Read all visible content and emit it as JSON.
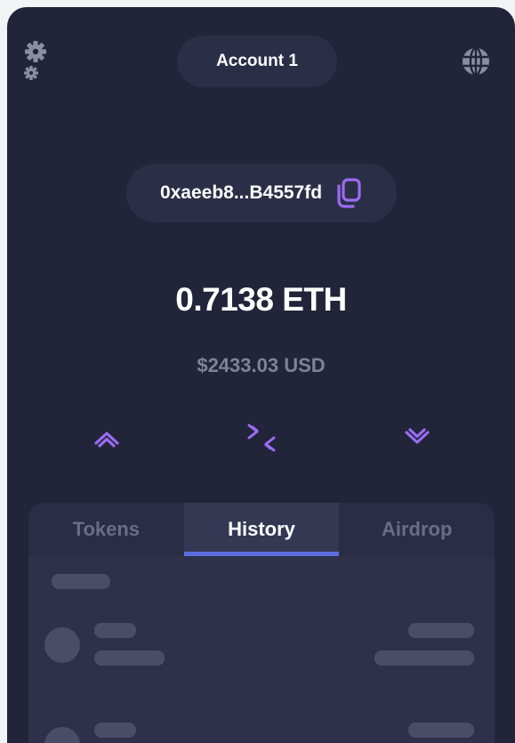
{
  "header": {
    "account_name": "Account 1",
    "settings_icon": "gear-icon",
    "network_icon": "globe-icon"
  },
  "address": {
    "short": "0xaeeb8...B4557fd",
    "copy_icon": "copy-icon"
  },
  "balance": {
    "crypto": "0.7138 ETH",
    "fiat": "$2433.03 USD"
  },
  "actions": [
    {
      "name": "send",
      "icon": "chevron-up-icon"
    },
    {
      "name": "swap",
      "icon": "swap-icon"
    },
    {
      "name": "receive",
      "icon": "chevron-down-icon"
    }
  ],
  "tabs": [
    {
      "label": "Tokens",
      "active": false
    },
    {
      "label": "History",
      "active": true
    },
    {
      "label": "Airdrop",
      "active": false
    }
  ],
  "colors": {
    "background": "#22243a",
    "panel": "#2b2e47",
    "accent": "#9b6cf2",
    "tab_indicator": "#5d6ddf",
    "muted_text": "#7f8299",
    "skeleton": "#4a4d66"
  }
}
